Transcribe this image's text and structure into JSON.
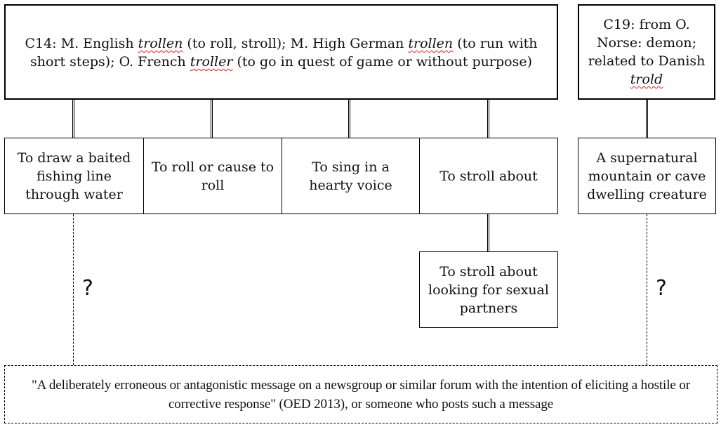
{
  "origin_c14": {
    "parts": [
      {
        "text": "C14: M. English ",
        "italic": false
      },
      {
        "text": "trollen",
        "italic": true
      },
      {
        "text": " (to roll, stroll); M. High German ",
        "italic": false
      },
      {
        "text": "trollen",
        "italic": true
      },
      {
        "text": " (to run with short steps); O. French ",
        "italic": false
      },
      {
        "text": "troller",
        "italic": true
      },
      {
        "text": " (to go in quest of game or without purpose)",
        "italic": false
      }
    ]
  },
  "origin_c19": {
    "parts": [
      {
        "text": "C19: from O. Norse: demon; related to Danish ",
        "italic": false
      },
      {
        "text": "trold",
        "italic": true
      }
    ]
  },
  "senses": [
    {
      "label": "To draw a baited fishing line through water"
    },
    {
      "label": "To roll or cause to roll"
    },
    {
      "label": "To sing in a hearty voice"
    },
    {
      "label": "To stroll about"
    }
  ],
  "sub_sense": {
    "label": "To stroll about looking for sexual partners"
  },
  "c19_sense": {
    "label": "A supernatural mountain or cave dwelling creature"
  },
  "unknown_links": [
    "?",
    "?"
  ],
  "modern_definition": {
    "text": "\"A deliberately erroneous or antagonistic message on a newsgroup or similar forum with the intention of eliciting a hostile or corrective response\" (OED 2013), or someone who posts such a message"
  }
}
